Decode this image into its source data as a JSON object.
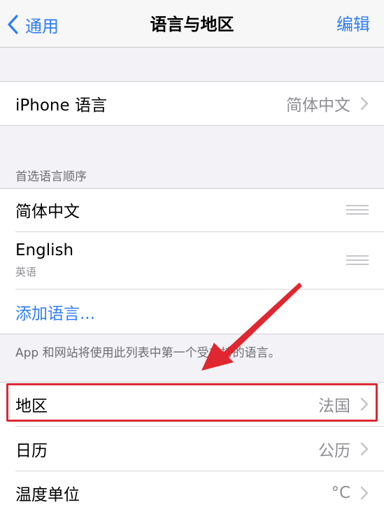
{
  "nav": {
    "back_label": "通用",
    "title": "语言与地区",
    "edit_label": "编辑"
  },
  "iphone_language": {
    "label": "iPhone 语言",
    "value": "简体中文"
  },
  "preferred_languages": {
    "header": "首选语言顺序",
    "items": [
      {
        "name": "简体中文",
        "subtitle": ""
      },
      {
        "name": "English",
        "subtitle": "英语"
      }
    ],
    "add_label": "添加语言...",
    "footer": "App 和网站将使用此列表中第一个受支持的语言。"
  },
  "settings": [
    {
      "label": "地区",
      "value": "法国"
    },
    {
      "label": "日历",
      "value": "公历"
    },
    {
      "label": "温度单位",
      "value": "°C"
    }
  ],
  "colors": {
    "accent": "#2f7cf6",
    "annotation": "#d92a34"
  },
  "icons": {
    "back": "chevron-left-icon",
    "disclosure": "chevron-right-icon",
    "reorder": "reorder-handle-icon"
  }
}
